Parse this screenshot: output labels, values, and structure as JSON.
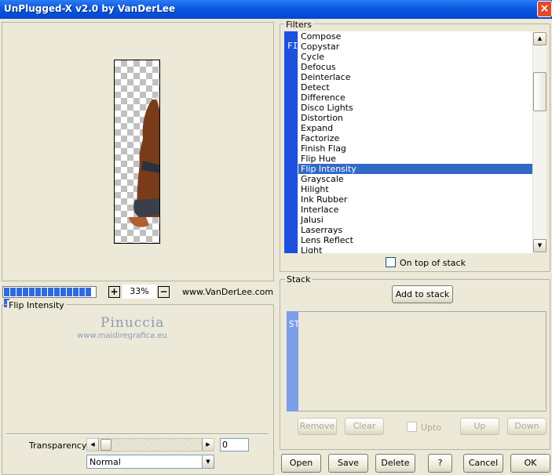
{
  "window": {
    "title": "UnPlugged-X v2.0 by VanDerLee",
    "close_icon": "×"
  },
  "preview": {
    "zoom": "33%",
    "zoom_in": "+",
    "zoom_out": "−",
    "website": "www.VanDerLee.com",
    "progress_segments": 15
  },
  "filters": {
    "label": "Filters",
    "strip_text": "FILTERS",
    "items": [
      "Compose",
      "Copystar",
      "Cycle",
      "Defocus",
      "Deinterlace",
      "Detect",
      "Difference",
      "Disco Lights",
      "Distortion",
      "Expand",
      "Factorize",
      "Finish Flag",
      "Flip Hue",
      "Flip Intensity",
      "Grayscale",
      "Hilight",
      "Ink Rubber",
      "Interlace",
      "Jalusi",
      "Laserrays",
      "Lens Reflect",
      "Light"
    ],
    "selected": "Flip Intensity",
    "on_top_label": "On top of stack",
    "on_top_checked": false
  },
  "stack": {
    "label": "Stack",
    "strip_text": "STACK",
    "add_label": "Add to stack",
    "remove_label": "Remove",
    "clear_label": "Clear",
    "upto_label": "Upto",
    "up_label": "Up",
    "down_label": "Down"
  },
  "effect_panel": {
    "label": "Flip Intensity",
    "watermark_name": "Pinuccia",
    "watermark_url": "www.maidiregrafica.eu",
    "transparency_label": "Transparency",
    "transparency_value": "0",
    "blend_mode": "Normal"
  },
  "footer": {
    "open": "Open",
    "save": "Save",
    "delete": "Delete",
    "help": "?",
    "cancel": "Cancel",
    "ok": "OK"
  },
  "colors": {
    "accent": "#316ac5",
    "title_bar": "#0a58e0",
    "strip": "#1e50e0",
    "face": "#ece9d8"
  }
}
